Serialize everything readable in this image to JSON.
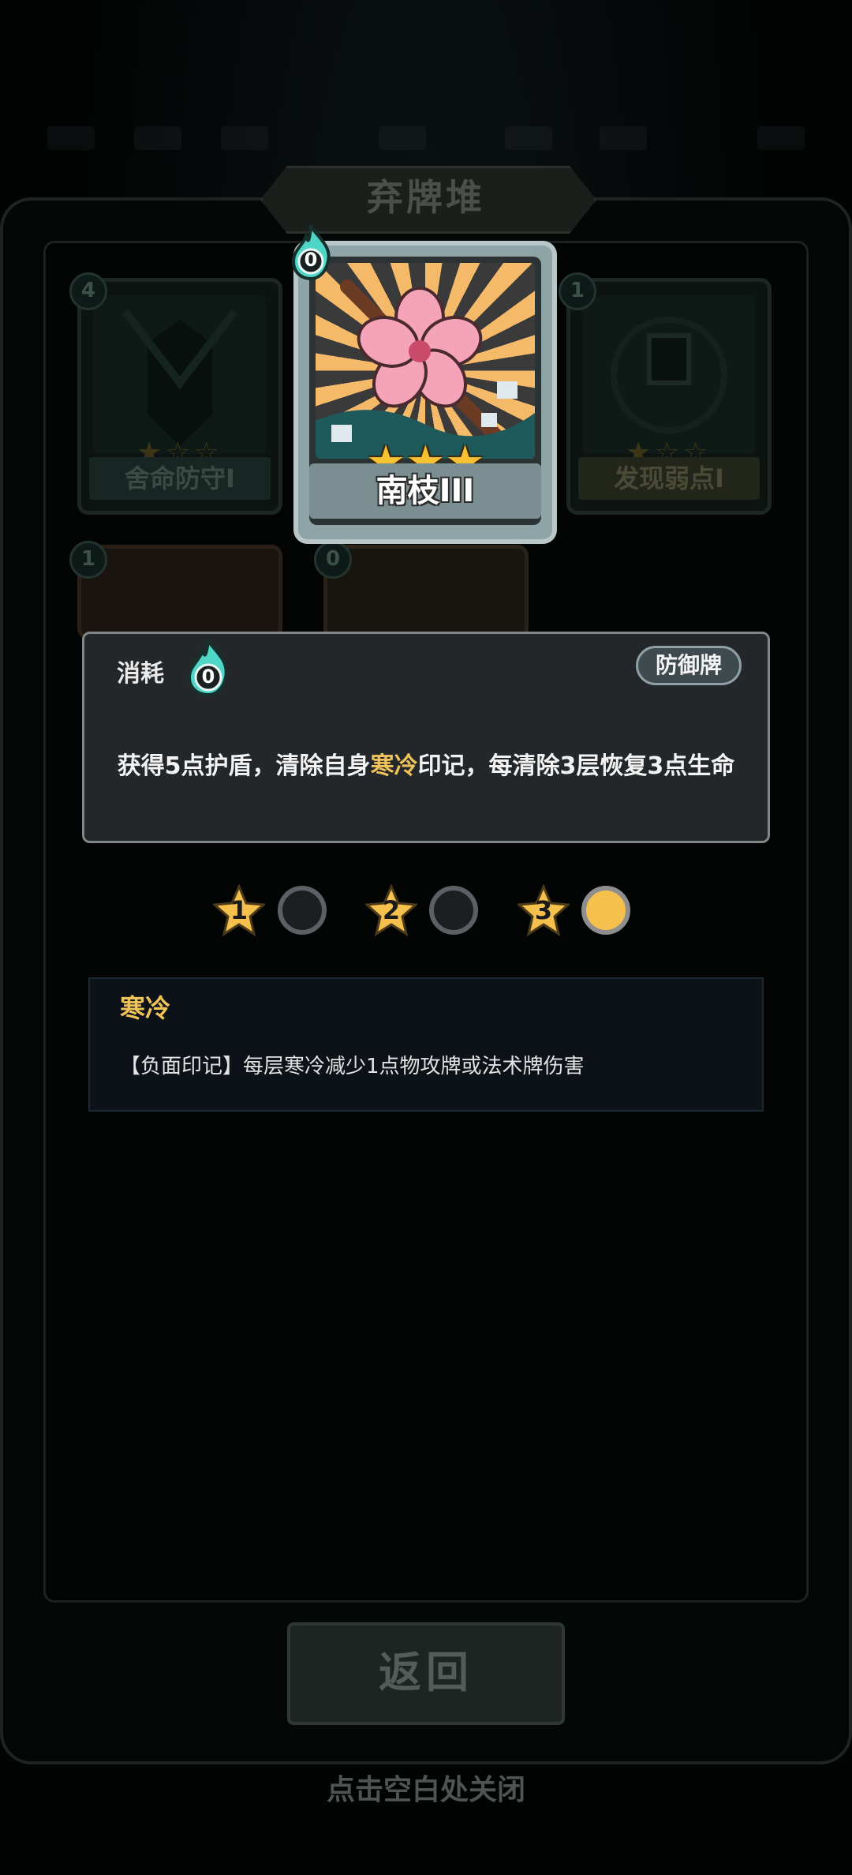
{
  "pile": {
    "title": "弃牌堆",
    "back_label": "返回",
    "close_hint": "点击空白处关闭"
  },
  "cards": [
    {
      "name": "舍命防守I",
      "cost": "4",
      "stars": 1
    },
    {
      "name": "发现弱点I",
      "cost": "1",
      "stars": 1
    },
    {
      "name": "",
      "cost": "1",
      "stars": 0
    },
    {
      "name": "",
      "cost": "0",
      "stars": 0
    }
  ],
  "featured": {
    "name": "南枝III",
    "cost": "0",
    "stars": 3,
    "art_icon": "cherry-blossom-branch"
  },
  "popup": {
    "consume_label": "消耗",
    "cost": "0",
    "type": "防御牌",
    "desc_a": "获得5点护盾，清除自身",
    "desc_keyword": "寒冷",
    "desc_b": "印记，每清除3层恢复3点生命"
  },
  "levels": [
    {
      "label": "1",
      "active": false
    },
    {
      "label": "2",
      "active": false
    },
    {
      "label": "3",
      "active": true
    }
  ],
  "keyword": {
    "title": "寒冷",
    "desc": "【负面印记】每层寒冷减少1点物攻牌或法术牌伤害"
  },
  "colors": {
    "highlight": "#f0c35a",
    "star": "#f7c232",
    "cost_flame": "#4fd6c6"
  }
}
